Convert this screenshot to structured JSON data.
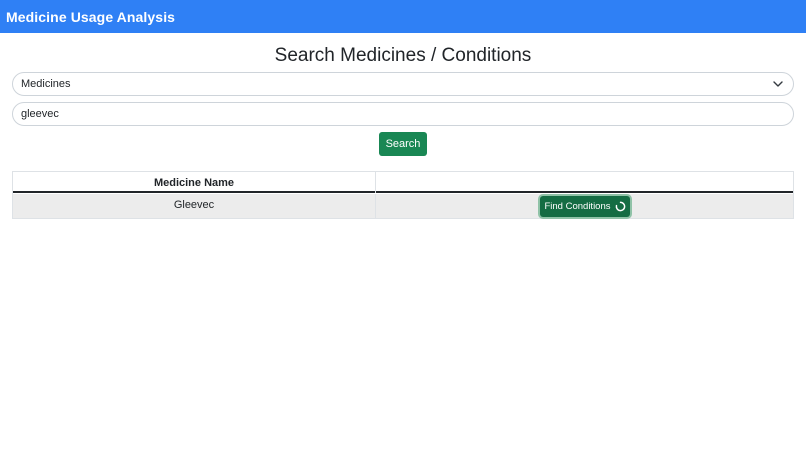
{
  "app": {
    "title": "Medicine Usage Analysis"
  },
  "page": {
    "heading": "Search Medicines / Conditions"
  },
  "search": {
    "type_selected": "Medicines",
    "query_value": "gleevec",
    "button_label": "Search"
  },
  "results": {
    "columns": [
      "Medicine Name",
      ""
    ],
    "rows": [
      {
        "name": "Gleevec",
        "action_label": "Find Conditions"
      }
    ]
  },
  "colors": {
    "navbar": "#2f80f5",
    "primary_button": "#198754",
    "active_button": "#146c43",
    "row_highlight": "#ececec"
  },
  "icons": {
    "select_arrow": "chevron-down-icon",
    "loading": "spinner-icon"
  }
}
